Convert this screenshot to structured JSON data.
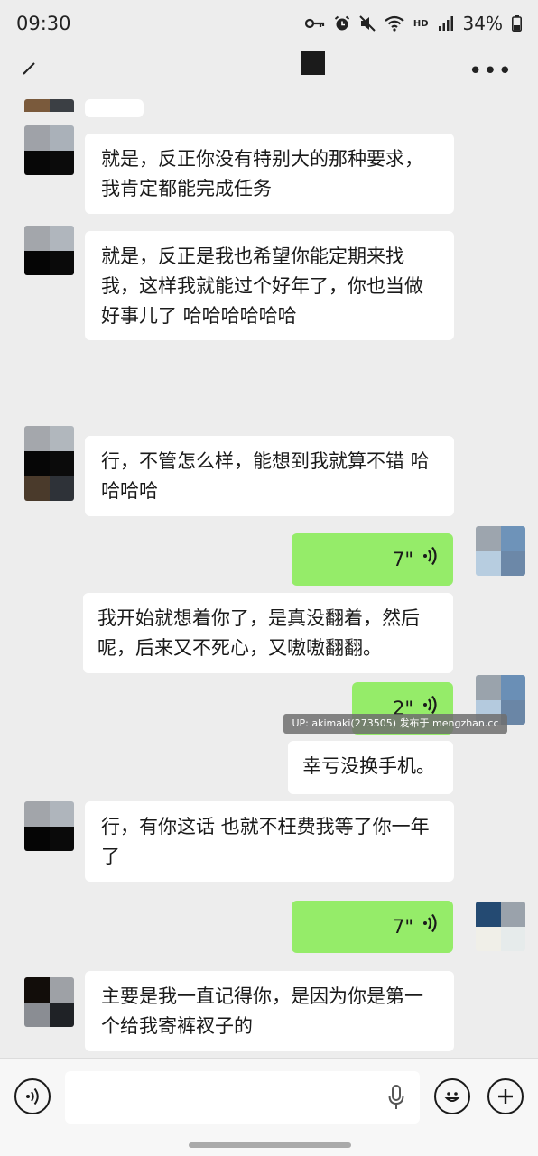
{
  "status_bar": {
    "time": "09:30",
    "hd_label": "HD",
    "battery": "34%"
  },
  "nav": {
    "more_icon": "more-dots-icon",
    "edit_icon": "edit-icon"
  },
  "messages": [
    {
      "side": "left",
      "text": "就是，反正你没有特别大的那种要求，我肯定都能完成任务"
    },
    {
      "side": "left",
      "text": "就是，反正是我也希望你能定期来找我，这样我就能过个好年了，你也当做好事儿了 哈哈哈哈哈哈"
    },
    {
      "side": "left",
      "text": "行，不管怎么样，能想到我就算不错 哈哈哈哈"
    },
    {
      "side": "right",
      "type": "voice",
      "duration": "7\""
    },
    {
      "side": "right",
      "type": "transcript",
      "text": "我开始就想着你了，是真没翻着，然后呢，后来又不死心，又嗷嗷翻翻。"
    },
    {
      "side": "right",
      "type": "voice",
      "duration": "2\""
    },
    {
      "side": "right",
      "type": "transcript",
      "text": "幸亏没换手机。"
    },
    {
      "side": "left",
      "text": "行，有你这话 也就不枉费我等了你一年了"
    },
    {
      "side": "right",
      "type": "voice",
      "duration": "7\""
    },
    {
      "side": "left",
      "text": "主要是我一直记得你，是因为你是第一个给我寄裤衩子的"
    }
  ],
  "watermark": "UP: akimaki(273505) 发布于 mengzhan.cc",
  "input_bar": {
    "voice_button_icon": "voice-mode-icon",
    "mic_icon": "microphone-icon",
    "emoji_icon": "emoji-icon",
    "add_icon": "plus-icon"
  },
  "colors": {
    "background": "#ededed",
    "bubble_left": "#ffffff",
    "bubble_right": "#95ec69"
  }
}
